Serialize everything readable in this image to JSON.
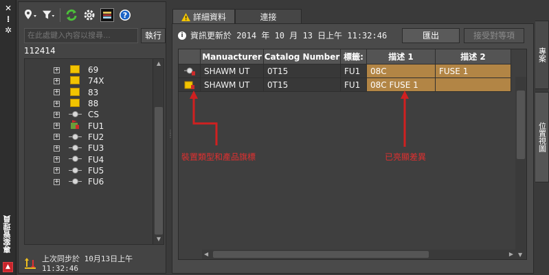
{
  "left_strip": {
    "close_glyph": "✕",
    "pin_glyph": "⁝",
    "settings_glyph": "✲",
    "title": "專案管理員"
  },
  "toolbar": {
    "icons": [
      "location-pin-icon",
      "filter-icon",
      "refresh-icon",
      "gear-icon",
      "image-view-icon",
      "help-icon"
    ]
  },
  "search": {
    "placeholder": "在此處鍵入內容以搜尋…",
    "exec_label": "執行"
  },
  "tree": {
    "root_id": "112414",
    "items": [
      {
        "label": "69",
        "icon": "box-icon"
      },
      {
        "label": "74X",
        "icon": "box-icon"
      },
      {
        "label": "83",
        "icon": "box-icon"
      },
      {
        "label": "88",
        "icon": "box-icon"
      },
      {
        "label": "CS",
        "icon": "device-node-icon"
      },
      {
        "label": "FU1",
        "icon": "flagged-device-icon"
      },
      {
        "label": "FU2",
        "icon": "device-node-icon"
      },
      {
        "label": "FU3",
        "icon": "device-node-icon"
      },
      {
        "label": "FU4",
        "icon": "device-node-icon"
      },
      {
        "label": "FU5",
        "icon": "device-node-icon"
      },
      {
        "label": "FU6",
        "icon": "device-node-icon"
      }
    ]
  },
  "sync": {
    "text": "上次同步於 10月13日上午 11:32:46"
  },
  "tabs": {
    "details": "詳細資料",
    "links": "連接"
  },
  "info": {
    "text": "資訊更新於 2014 年 10 月 13 日上午 11:32:46",
    "export_label": "匯出",
    "accept_label": "接受對等項"
  },
  "grid": {
    "headers": [
      "Manuacturer",
      "Catalog Number",
      "標籤:",
      "描述 1",
      "描述 2"
    ],
    "rows": [
      {
        "manufacturer": "SHAWM UT",
        "catalog": "0T15",
        "tag": "FU1",
        "desc1": "08C",
        "desc2": "FUSE 1"
      },
      {
        "manufacturer": "SHAWM UT",
        "catalog": "0T15",
        "tag": "FU1",
        "desc1": "08C FUSE 1",
        "desc2": ""
      }
    ]
  },
  "annotations": {
    "left": "裝置類型和產品旗標",
    "right": "已亮顯差異"
  },
  "right_tabs": {
    "first": "專案",
    "second": "位置視圖"
  },
  "colors": {
    "highlight": "#b28545",
    "annotation": "#e03030"
  }
}
